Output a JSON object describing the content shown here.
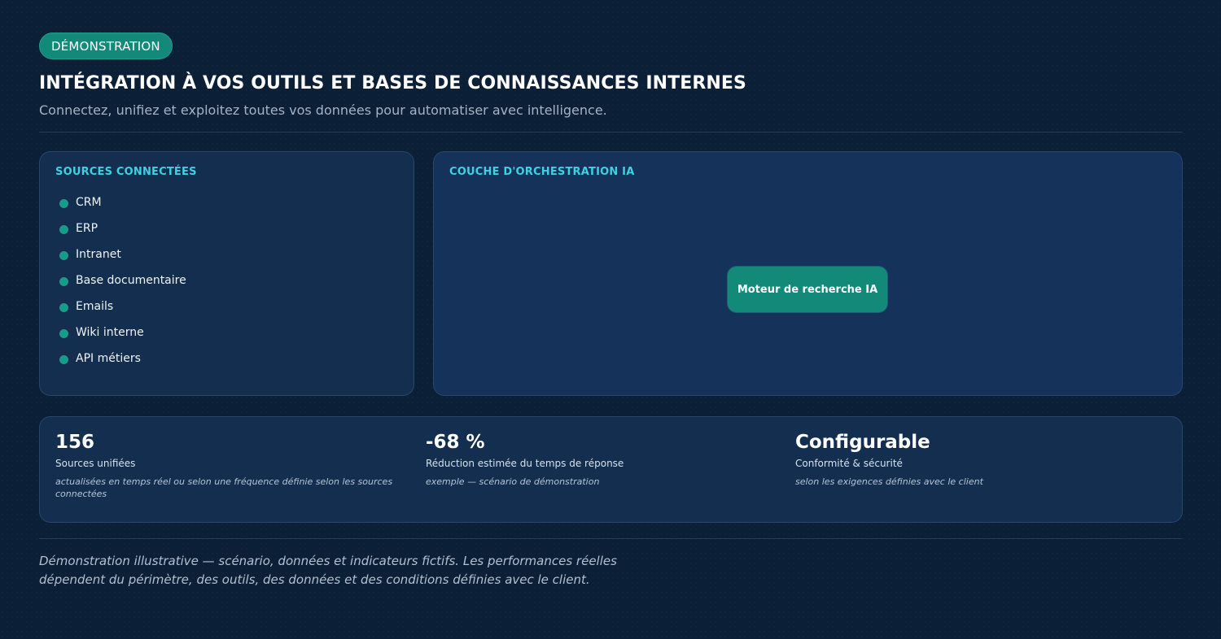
{
  "header": {
    "badge": "DÉMONSTRATION",
    "title": "INTÉGRATION À VOS OUTILS ET BASES DE CONNAISSANCES INTERNES",
    "subtitle": "Connectez, unifiez et exploitez toutes vos données pour automatiser avec intelligence."
  },
  "sources": {
    "label": "SOURCES CONNECTÉES",
    "items": [
      "CRM",
      "ERP",
      "Intranet",
      "Base documentaire",
      "Emails",
      "Wiki interne",
      "API métiers"
    ]
  },
  "orchestration": {
    "label": "COUCHE D'ORCHESTRATION IA",
    "engine_label": "Moteur de recherche IA"
  },
  "stats": [
    {
      "value": "156",
      "label": "Sources unifiées",
      "note": "actualisées en temps réel ou selon une fréquence définie selon les sources connectées"
    },
    {
      "value": "-68 %",
      "label": "Réduction estimée du temps de réponse",
      "note": "exemple — scénario de démonstration"
    },
    {
      "value": "Configurable",
      "label": "Conformité & sécurité",
      "note": "selon les exigences définies avec le client"
    }
  ],
  "footer": {
    "disclaimer": "Démonstration illustrative — scénario, données et indicateurs fictifs. Les performances réelles dépendent du périmètre, des outils, des données et des conditions définies avec le client."
  },
  "colors": {
    "background": "#0b1f36",
    "panel": "#132e4f",
    "accent_teal": "#13897a",
    "accent_cyan": "#3ed1e3"
  }
}
